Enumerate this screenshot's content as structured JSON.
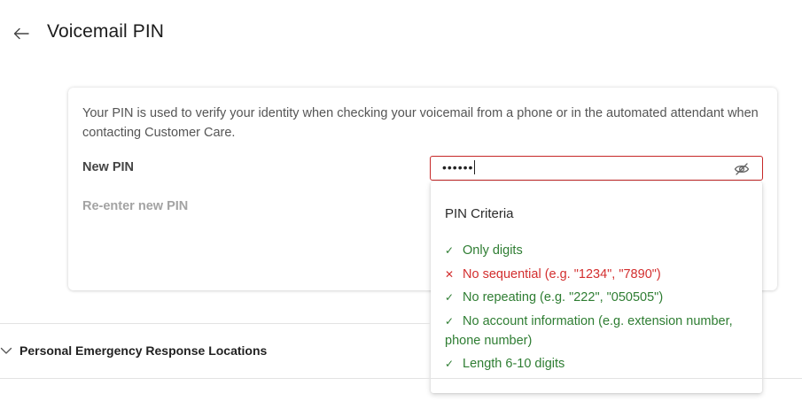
{
  "header": {
    "title": "Voicemail PIN",
    "back_icon": "arrow-left-icon"
  },
  "card": {
    "description": "Your PIN is used to verify your identity when checking your voicemail from a phone or in the automated attendant when contacting Customer Care.",
    "new_pin_label": "New PIN",
    "reenter_pin_label": "Re-enter new PIN"
  },
  "pin_field": {
    "masked_value": "••••••",
    "visibility_icon": "eye-off-icon",
    "border_color": "#c62828"
  },
  "criteria": {
    "title": "PIN Criteria",
    "items": [
      {
        "label": "Only digits",
        "status": "ok"
      },
      {
        "label": "No sequential (e.g. \"1234\", \"7890\")",
        "status": "fail"
      },
      {
        "label": "No repeating (e.g. \"222\", \"050505\")",
        "status": "ok"
      },
      {
        "label": "No account information (e.g. extension number, phone number)",
        "status": "ok"
      },
      {
        "label": "Length 6-10 digits",
        "status": "ok"
      }
    ],
    "ok_color": "#2e7d32",
    "fail_color": "#d32f2f"
  },
  "section": {
    "title": "Personal Emergency Response Locations",
    "icon": "chevron-down-icon"
  }
}
